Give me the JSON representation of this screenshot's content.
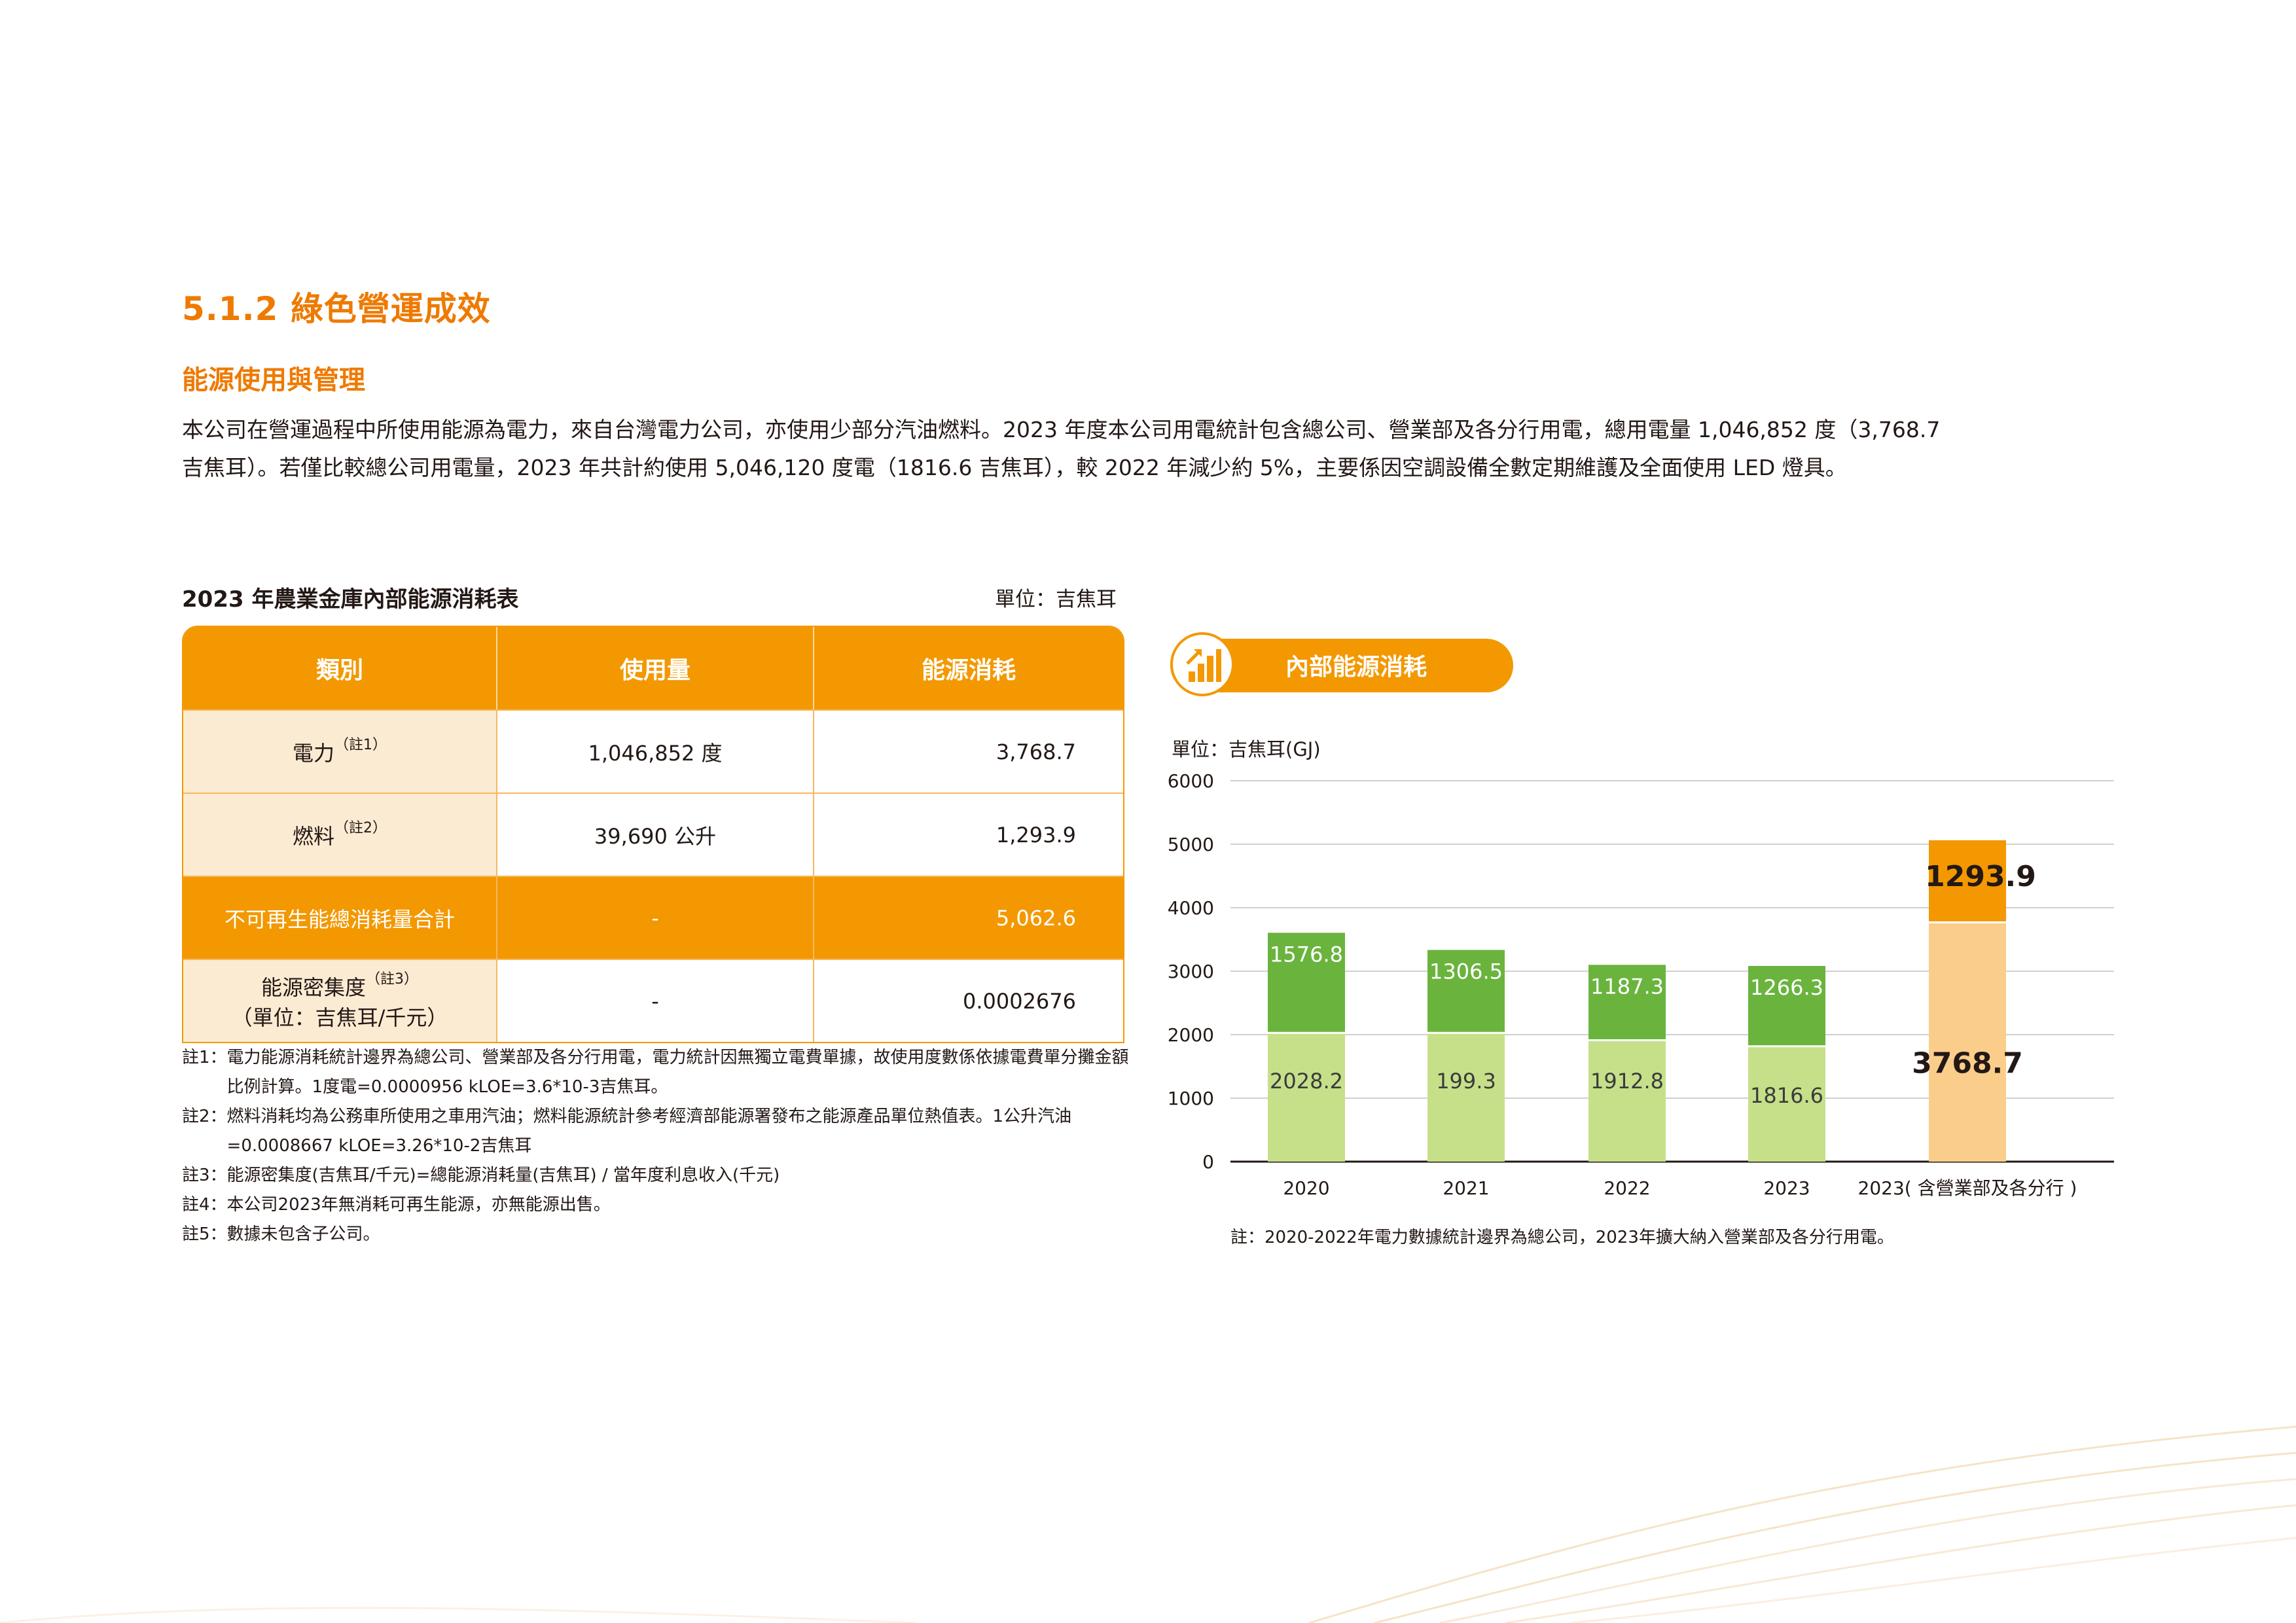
{
  "section_title": "5.1.2 綠色營運成效",
  "sub_title": "能源使用與管理",
  "intro": {
    "line1": "本公司在營運過程中所使用能源為電力，來自台灣電力公司，亦使用少部分汽油燃料。2023 年度本公司用電統計包含總公司、營業部及各分行用電，總用電量 1,046,852 度（3,768.7",
    "line2": "吉焦耳）。若僅比較總公司用電量，2023 年共計約使用 5,046,120 度電（1816.6 吉焦耳），較 2022 年減少約 5%，主要係因空調設備全數定期維護及全面使用 LED 燈具。"
  },
  "table": {
    "title": "2023 年農業金庫內部能源消耗表",
    "unit": "單位：吉焦耳",
    "headers": [
      "類別",
      "使用量",
      "能源消耗"
    ],
    "rows": [
      {
        "category": "電力",
        "note": "（註1）",
        "usage": "1,046,852 度",
        "value": "3,768.7"
      },
      {
        "category": "燃料",
        "note": "（註2）",
        "usage": "39,690 公升",
        "value": "1,293.9"
      },
      {
        "category": "不可再生能總消耗量合計",
        "note": "",
        "usage": "-",
        "value": "5,062.6"
      },
      {
        "category": "能源密集度",
        "note": "（註3）",
        "category2": "（單位：吉焦耳/千元）",
        "usage": "-",
        "value": "0.0002676"
      }
    ]
  },
  "notes": [
    {
      "key": "註1：",
      "text": "電力能源消耗統計邊界為總公司、營業部及各分行用電，電力統計因無獨立電費單據，故使用度數係依據電費單分攤金額比例計算。1度電=0.0000956 kLOE=3.6*10-3吉焦耳。"
    },
    {
      "key": "註2：",
      "text": "燃料消耗均為公務車所使用之車用汽油；燃料能源統計參考經濟部能源署發布之能源產品單位熱值表。1公升汽油=0.0008667 kLOE=3.26*10-2吉焦耳"
    },
    {
      "key": "註3：",
      "text": "能源密集度(吉焦耳/千元)=總能源消耗量(吉焦耳) / 當年度利息收入(千元)"
    },
    {
      "key": "註4：",
      "text": "本公司2023年無消耗可再生能源，亦無能源出售。"
    },
    {
      "key": "註5：",
      "text": "數據未包含子公司。"
    }
  ],
  "chart_badge": "內部能源消耗",
  "chart_badge_icon": "bar-growth-icon",
  "chart_note": "註：2020-2022年電力數據統計邊界為總公司，2023年擴大納入營業部及各分行用電。",
  "colors": {
    "accent": "#ee7a00",
    "orange": "#f39800",
    "green_dark": "#6ab43e",
    "green_light": "#c6e08a",
    "orange_light": "#fbcd8a"
  },
  "chart_data": {
    "type": "bar",
    "stacked": true,
    "ylabel": "單位：吉焦耳(GJ)",
    "ylim": [
      0,
      6000
    ],
    "yticks": [
      0,
      1000,
      2000,
      3000,
      4000,
      5000,
      6000
    ],
    "categories": [
      "2020",
      "2021",
      "2022",
      "2023",
      "2023( 含營業部及各分行 )"
    ],
    "series": [
      {
        "values": [
          2028.2,
          2028.2,
          1912.8,
          1816.6,
          3768.7
        ],
        "labels": [
          "2028.2",
          "199.3",
          "1912.8",
          "1816.6",
          "3768.7"
        ]
      },
      {
        "values": [
          1576.8,
          1306.5,
          1187.3,
          1266.3,
          1293.9
        ],
        "labels": [
          "1576.8",
          "1306.5",
          "1187.3",
          "1266.3",
          "1293.9"
        ]
      }
    ],
    "grid": true,
    "legend": "none"
  }
}
